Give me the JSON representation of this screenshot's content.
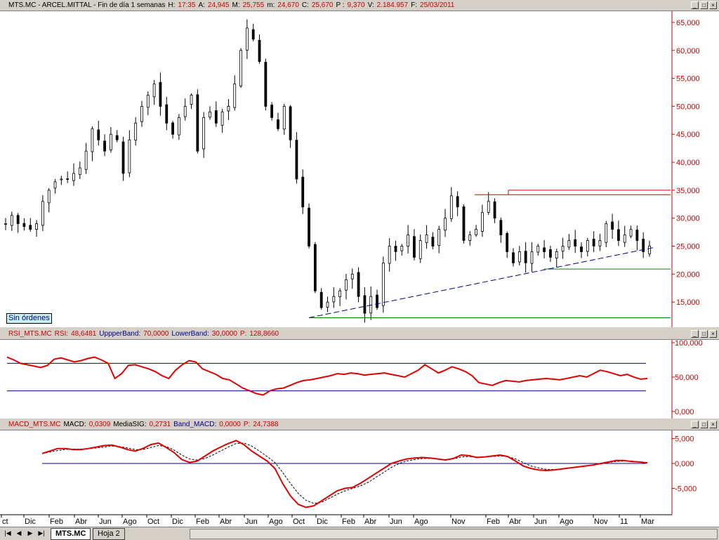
{
  "main_title": {
    "parts": [
      {
        "t": "MTS.MC - ARCEL.MITTAL - Fin de día 1 semanas",
        "c": "k"
      },
      {
        "t": "H:",
        "c": "k"
      },
      {
        "t": "17:35",
        "c": "v"
      },
      {
        "t": "A:",
        "c": "k"
      },
      {
        "t": "24,945",
        "c": "v"
      },
      {
        "t": "M:",
        "c": "k"
      },
      {
        "t": "25,755",
        "c": "v"
      },
      {
        "t": "m:",
        "c": "k"
      },
      {
        "t": "24,670",
        "c": "v"
      },
      {
        "t": "C:",
        "c": "k"
      },
      {
        "t": "25,670",
        "c": "v"
      },
      {
        "t": "P :",
        "c": "k"
      },
      {
        "t": "9,370",
        "c": "v"
      },
      {
        "t": "V:",
        "c": "k"
      },
      {
        "t": "2.184.957",
        "c": "v"
      },
      {
        "t": "F:",
        "c": "k"
      },
      {
        "t": "25/03/2011",
        "c": "v"
      }
    ]
  },
  "rsi_title": {
    "parts": [
      {
        "t": "RSI_MTS.MC",
        "c": "v"
      },
      {
        "t": "RSI:",
        "c": "v"
      },
      {
        "t": "48,6481",
        "c": "v"
      },
      {
        "t": "UppperBand:",
        "c": "b"
      },
      {
        "t": "70,0000",
        "c": "v"
      },
      {
        "t": "LowerBand:",
        "c": "b"
      },
      {
        "t": "30,0000",
        "c": "v"
      },
      {
        "t": "P:",
        "c": "v"
      },
      {
        "t": "128,8660",
        "c": "v"
      }
    ]
  },
  "macd_title": {
    "parts": [
      {
        "t": "MACD_MTS.MC",
        "c": "v"
      },
      {
        "t": "MACD:",
        "c": "k"
      },
      {
        "t": "0,0309",
        "c": "v"
      },
      {
        "t": "MediaSIG:",
        "c": "k"
      },
      {
        "t": "0,2731",
        "c": "v"
      },
      {
        "t": "Band_MACD:",
        "c": "b"
      },
      {
        "t": "0,0000",
        "c": "v"
      },
      {
        "t": "P:",
        "c": "v"
      },
      {
        "t": "24,7388",
        "c": "v"
      }
    ]
  },
  "window_buttons": [
    "_",
    "□",
    "×"
  ],
  "sin_ordenes": "Sin órdenes",
  "tabs": {
    "active": "MTS.MC",
    "inactive": "Hoja 2"
  },
  "nav_buttons": [
    "|◀",
    "◀",
    "▶",
    "▶|"
  ],
  "colors": {
    "price_axis": "#cc0000",
    "candle": "#000000",
    "rsi": "#dd0000",
    "macd": "#dd0000",
    "band": "#00008b",
    "support": "#008000",
    "resistance": "#cc0000",
    "trend": "#00008b"
  },
  "chart_data": [
    {
      "type": "candlestick",
      "title": "MTS.MC - ARCEL.MITTAL - Fin de día 1 semanas",
      "x_tick_labels": [
        "ct",
        "Dic",
        "Feb",
        "Abr",
        "Jun",
        "Ago",
        "Oct",
        "Dic",
        "Feb",
        "Abr",
        "Jun",
        "Ago",
        "Oct",
        "Dic",
        "Feb",
        "Abr",
        "Jun",
        "Ago",
        "Nov",
        "Feb",
        "Abr",
        "Jun",
        "Ago",
        "Nov",
        "11",
        "Mar"
      ],
      "y_tick_labels": [
        "65,000",
        "60,000",
        "55,000",
        "50,000",
        "45,000",
        "40,000",
        "35,000",
        "30,000",
        "25,000",
        "20,000",
        "15,000"
      ],
      "ylim": [
        10.5,
        67
      ],
      "close_path_points": [
        29,
        30.5,
        29,
        28.5,
        28,
        29,
        33,
        35,
        36.5,
        37,
        37,
        38,
        39,
        42,
        46,
        44,
        42,
        45,
        44,
        38,
        44,
        47,
        50,
        52,
        54,
        50,
        47,
        45,
        48,
        50,
        52,
        42,
        48,
        49,
        47,
        49,
        50,
        54,
        60,
        64,
        62,
        58,
        50,
        48,
        46,
        50,
        44,
        37,
        32,
        25,
        17,
        14,
        15,
        16,
        17,
        19,
        20,
        16,
        13,
        16,
        14,
        22,
        25,
        24,
        25,
        27,
        23,
        26,
        27,
        25,
        28,
        30,
        34,
        32,
        26,
        27,
        28,
        31,
        33,
        30,
        27,
        24,
        22,
        24,
        22,
        24,
        25,
        24,
        23,
        24,
        25,
        26,
        25,
        24,
        26,
        25,
        26,
        29,
        28,
        26,
        27,
        28,
        26,
        24,
        25
      ],
      "resistance_lines": [
        34.2,
        35.0
      ],
      "support_lines": [
        20.9,
        12.2
      ],
      "trendline": {
        "start_value": 12.2,
        "end_value": 24.8
      }
    },
    {
      "type": "line",
      "title": "RSI_MTS.MC",
      "series": [
        {
          "name": "RSI",
          "values": [
            79,
            75,
            70,
            68,
            66,
            64,
            67,
            76,
            78,
            75,
            72,
            74,
            77,
            79,
            75,
            70,
            48,
            55,
            67,
            68,
            65,
            62,
            58,
            52,
            48,
            60,
            68,
            74,
            72,
            62,
            58,
            54,
            48,
            46,
            40,
            34,
            30,
            26,
            24,
            30,
            33,
            34,
            38,
            42,
            45,
            46,
            48,
            50,
            52,
            55,
            54,
            56,
            55,
            53,
            54,
            55,
            56,
            54,
            52,
            50,
            55,
            60,
            68,
            62,
            56,
            60,
            65,
            62,
            58,
            52,
            42,
            40,
            38,
            42,
            45,
            44,
            43,
            45,
            46,
            47,
            48,
            47,
            46,
            48,
            50,
            52,
            50,
            55,
            60,
            58,
            55,
            52,
            54,
            50,
            47,
            48
          ]
        }
      ],
      "bands": [
        70,
        30
      ],
      "y_tick_labels": [
        "100,000",
        "50,000",
        "0,000"
      ],
      "ylim": [
        0,
        100
      ]
    },
    {
      "type": "line",
      "title": "MACD_MTS.MC",
      "series": [
        {
          "name": "MACD",
          "values": [
            2,
            2.5,
            3,
            3,
            2.8,
            2.8,
            3,
            3.3,
            3.6,
            3.7,
            3.3,
            2.8,
            2.5,
            3,
            3.8,
            4.1,
            3.2,
            2.2,
            0.8,
            0.2,
            0.5,
            1.5,
            2.5,
            3.3,
            4,
            4.6,
            3.8,
            2.5,
            1.5,
            0.5,
            -1,
            -4,
            -6.5,
            -8.2,
            -8.8,
            -8.5,
            -7.5,
            -6.5,
            -5.5,
            -5,
            -4.8,
            -4,
            -3,
            -2,
            -1,
            0,
            0.5,
            0.9,
            1.1,
            1.2,
            1.1,
            0.9,
            0.7,
            1,
            1.7,
            1.6,
            1.2,
            1.3,
            1.5,
            1.7,
            1.4,
            0.5,
            -0.5,
            -1,
            -1.3,
            -1.4,
            -1.3,
            -1.1,
            -0.9,
            -0.7,
            -0.5,
            -0.3,
            0,
            0.3,
            0.6,
            0.6,
            0.4,
            0.3,
            0.1
          ]
        },
        {
          "name": "MediaSIG",
          "values": [
            2,
            2.3,
            2.6,
            2.8,
            2.9,
            2.9,
            3,
            3.1,
            3.3,
            3.5,
            3.4,
            3.1,
            2.8,
            2.8,
            3.2,
            3.6,
            3.4,
            2.7,
            1.7,
            0.9,
            0.7,
            1,
            1.7,
            2.5,
            3.3,
            4,
            4.1,
            3.5,
            2.5,
            1.4,
            0.2,
            -1.8,
            -4,
            -6,
            -7.4,
            -8,
            -7.8,
            -7,
            -6.2,
            -5.5,
            -5,
            -4.5,
            -3.8,
            -2.8,
            -1.8,
            -0.8,
            0,
            0.5,
            0.8,
            1,
            1,
            0.9,
            0.8,
            0.9,
            1.3,
            1.4,
            1.3,
            1.3,
            1.4,
            1.5,
            1.4,
            0.9,
            0.2,
            -0.5,
            -0.9,
            -1.2,
            -1.2,
            -1.1,
            -0.9,
            -0.7,
            -0.5,
            -0.3,
            -0.1,
            0.2,
            0.4,
            0.5,
            0.5,
            0.3,
            0.2
          ]
        }
      ],
      "zero_line": 0,
      "y_tick_labels": [
        "5,000",
        "0,000",
        "-5,000"
      ],
      "ylim": [
        -10,
        5.5
      ]
    }
  ]
}
